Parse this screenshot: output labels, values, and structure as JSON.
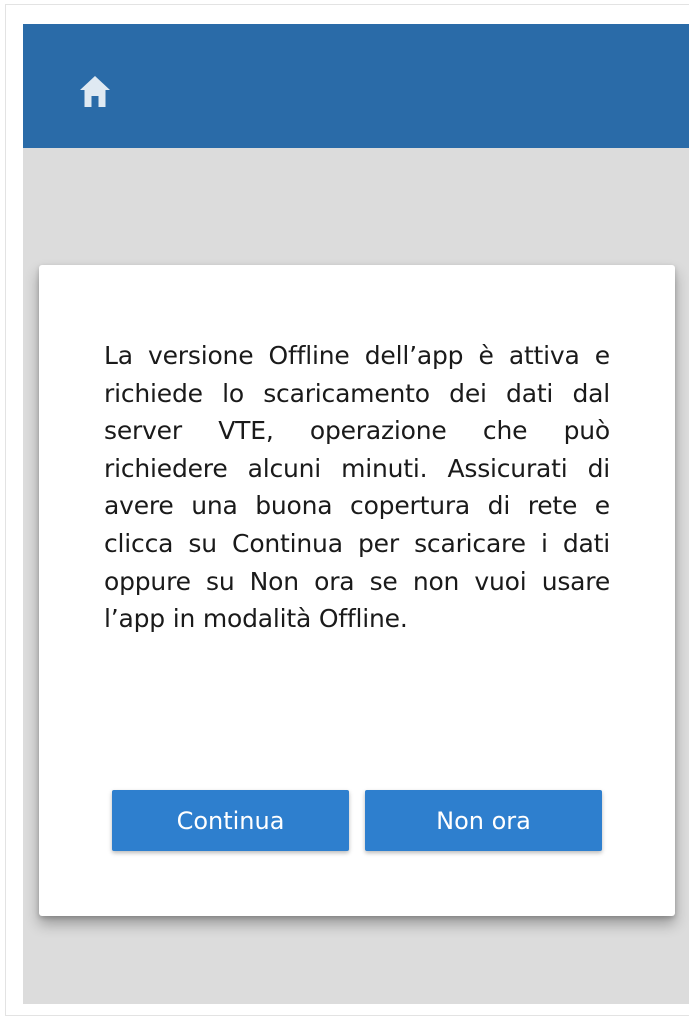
{
  "header": {
    "icon": "home-icon",
    "background": "#2a6ba8"
  },
  "dialog": {
    "message": "La versione Offline dell’app è attiva e richiede lo scaricamento dei dati dal server VTE, operazione che può richiedere alcuni minuti. Assicurati di avere una buona copertura di rete e clicca su Continua per scaricare i dati oppure su Non ora se non vuoi usare l’app in modalità Offline.",
    "continue_label": "Continua",
    "not_now_label": "Non ora",
    "button_color": "#2e7fce"
  }
}
